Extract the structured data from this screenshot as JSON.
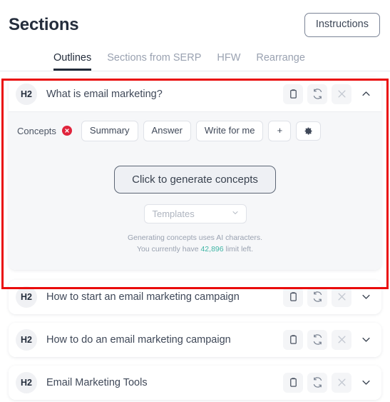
{
  "header": {
    "title": "Sections",
    "instructions_label": "Instructions"
  },
  "tabs": [
    {
      "label": "Outlines",
      "active": true
    },
    {
      "label": "Sections from SERP",
      "active": false
    },
    {
      "label": "HFW",
      "active": false
    },
    {
      "label": "Rearrange",
      "active": false
    }
  ],
  "row_actions": {
    "copy": "clipboard-icon",
    "regenerate": "refresh-icon",
    "delete": "close-icon",
    "collapse": "chevron-up-icon",
    "expand": "chevron-down-icon"
  },
  "sections": [
    {
      "level": "H2",
      "title": "What is email marketing?",
      "expanded": true
    },
    {
      "level": "H2",
      "title": "How to start an email marketing campaign",
      "expanded": false
    },
    {
      "level": "H2",
      "title": "How to do an email marketing campaign",
      "expanded": false
    },
    {
      "level": "H2",
      "title": "Email Marketing Tools",
      "expanded": false
    }
  ],
  "expanded_panel": {
    "concepts_label": "Concepts",
    "concepts_error_icon": "error-circle-icon",
    "mode_pills": [
      "Summary",
      "Answer",
      "Write for me"
    ],
    "add_label": "+",
    "settings_icon": "gear-icon",
    "generate_button": "Click to generate concepts",
    "templates_placeholder": "Templates",
    "templates_chevron": "chevron-down-icon",
    "hint_line1": "Generating concepts uses AI characters.",
    "hint_line2_prefix": "You currently have ",
    "hint_amount": "42,896",
    "hint_line2_suffix": " limit left."
  },
  "colors": {
    "annotation": "#ea0c0c",
    "accent_text": "#3fb5a5",
    "error_badge": "#e0243c",
    "title_text": "#242d3c",
    "panel_bg": "#f6f7f9"
  }
}
